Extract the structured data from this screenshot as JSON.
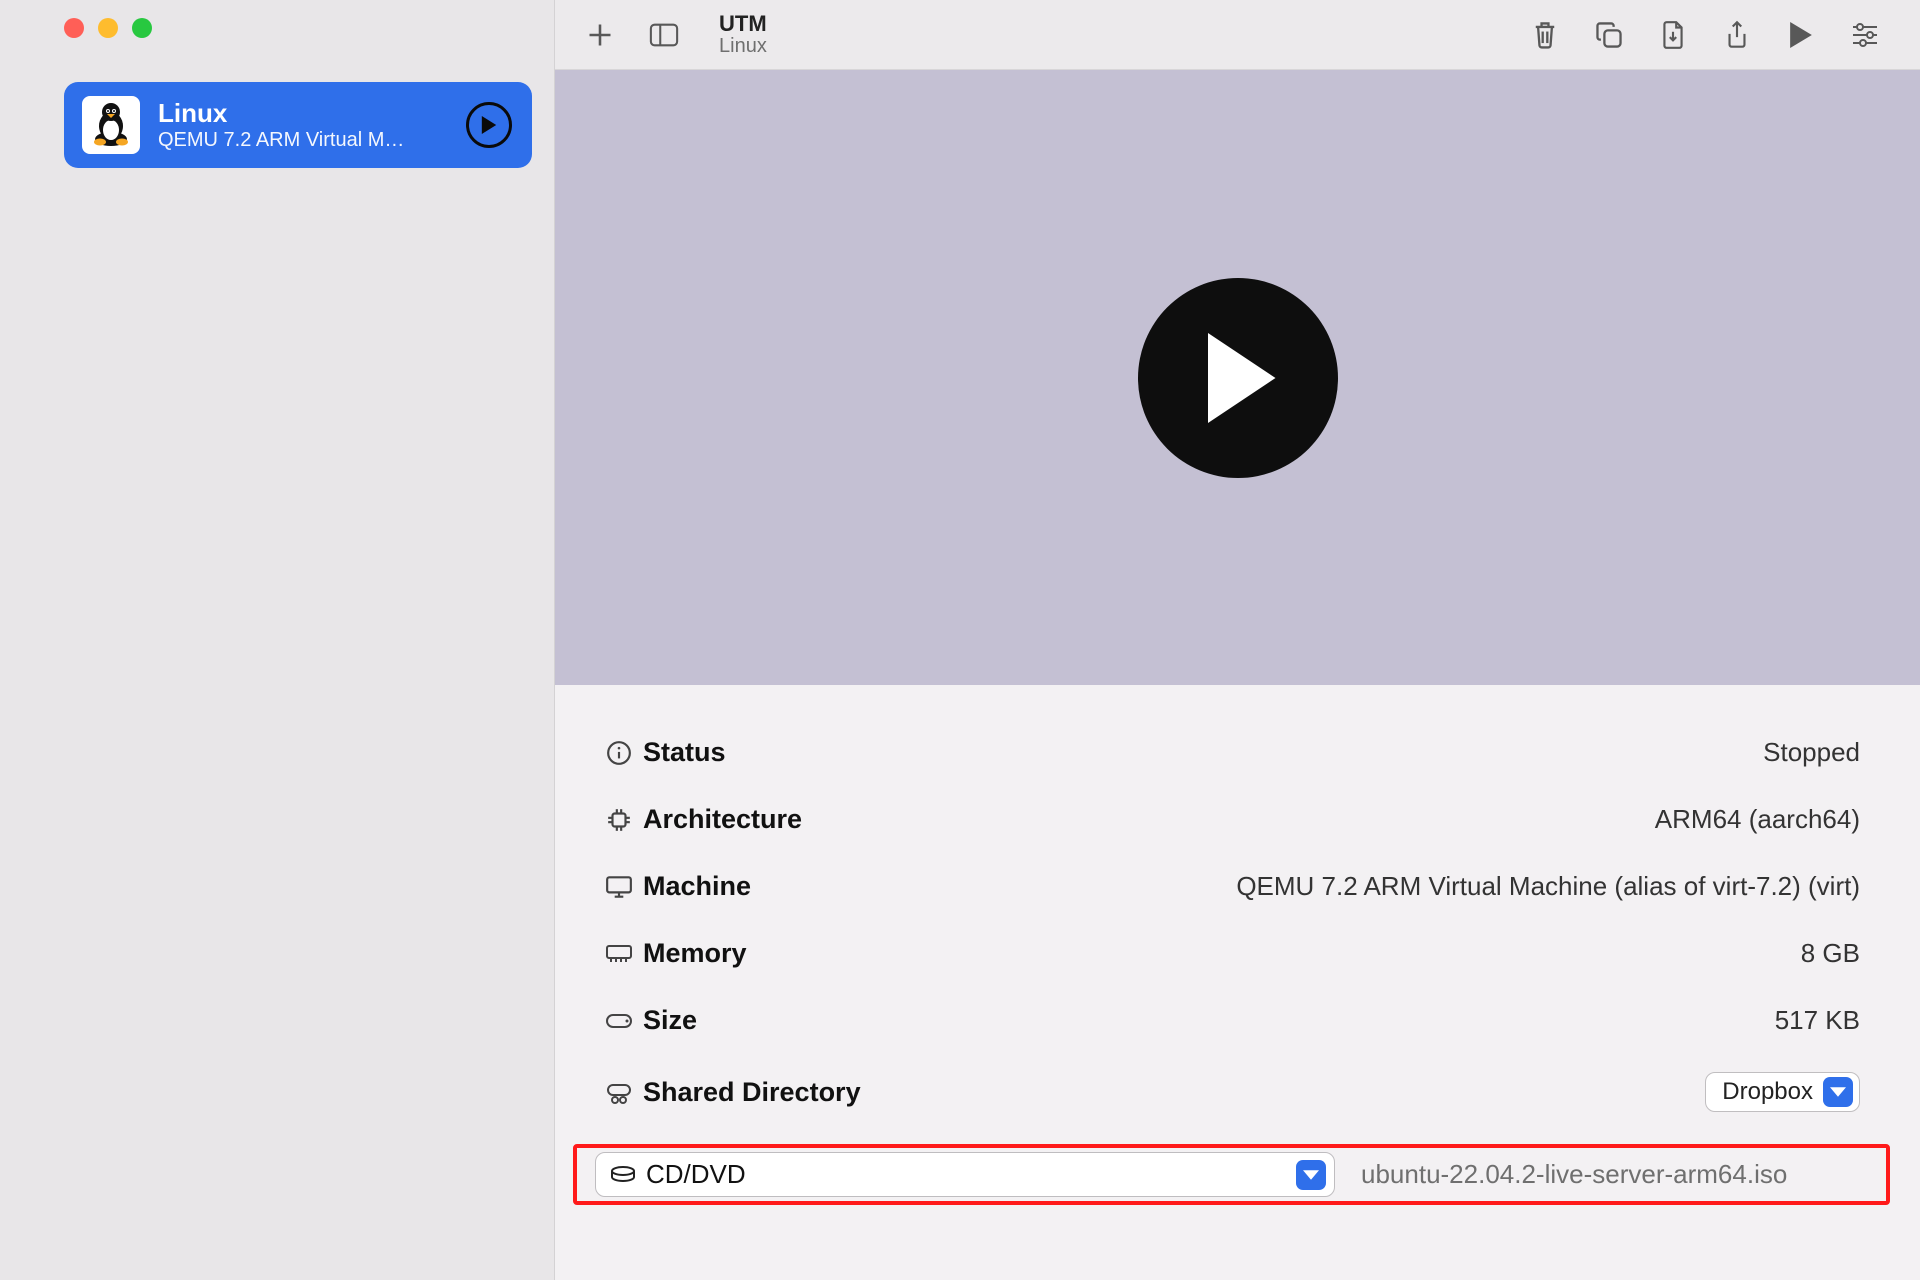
{
  "header": {
    "title": "UTM",
    "subtitle": "Linux"
  },
  "sidebar": {
    "vms": [
      {
        "name": "Linux",
        "subtitle": "QEMU 7.2 ARM Virtual M…"
      }
    ]
  },
  "details": {
    "status_label": "Status",
    "status_value": "Stopped",
    "arch_label": "Architecture",
    "arch_value": "ARM64 (aarch64)",
    "machine_label": "Machine",
    "machine_value": "QEMU 7.2 ARM Virtual Machine (alias of virt-7.2) (virt)",
    "memory_label": "Memory",
    "memory_value": "8 GB",
    "size_label": "Size",
    "size_value": "517 KB",
    "sharedir_label": "Shared Directory",
    "sharedir_value": "Dropbox",
    "cd_label": "CD/DVD",
    "cd_value": "ubuntu-22.04.2-live-server-arm64.iso"
  }
}
